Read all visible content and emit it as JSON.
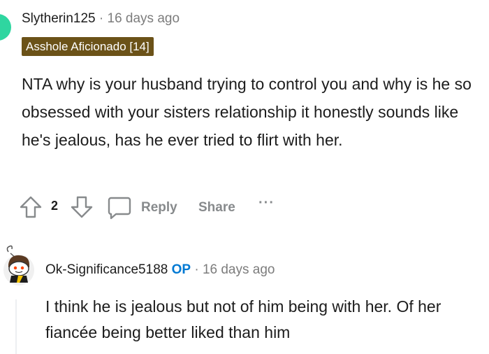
{
  "comment": {
    "username": "Slytherin125",
    "separator": "·",
    "time_ago": "16 days ago",
    "flair": "Asshole Aficionado [14]",
    "body": "NTA why is your husband trying to control you and why is he so obsessed with your sisters relationship it honestly sounds like he's jealous, has he ever tried to flirt with her.",
    "score": "2",
    "reply_label": "Reply",
    "share_label": "Share",
    "more_label": "···"
  },
  "reply": {
    "username": "Ok-Significance5188",
    "op_badge": "OP",
    "separator": "·",
    "time_ago": "16 days ago",
    "body": "I think he is jealous but not of him being with her. Of her fiancée being better liked than him"
  },
  "colors": {
    "flair_bg": "#6b5218",
    "op_blue": "#0079d3",
    "meta_gray": "#7c7c7c",
    "avatar_green": "#2fd6a0"
  }
}
